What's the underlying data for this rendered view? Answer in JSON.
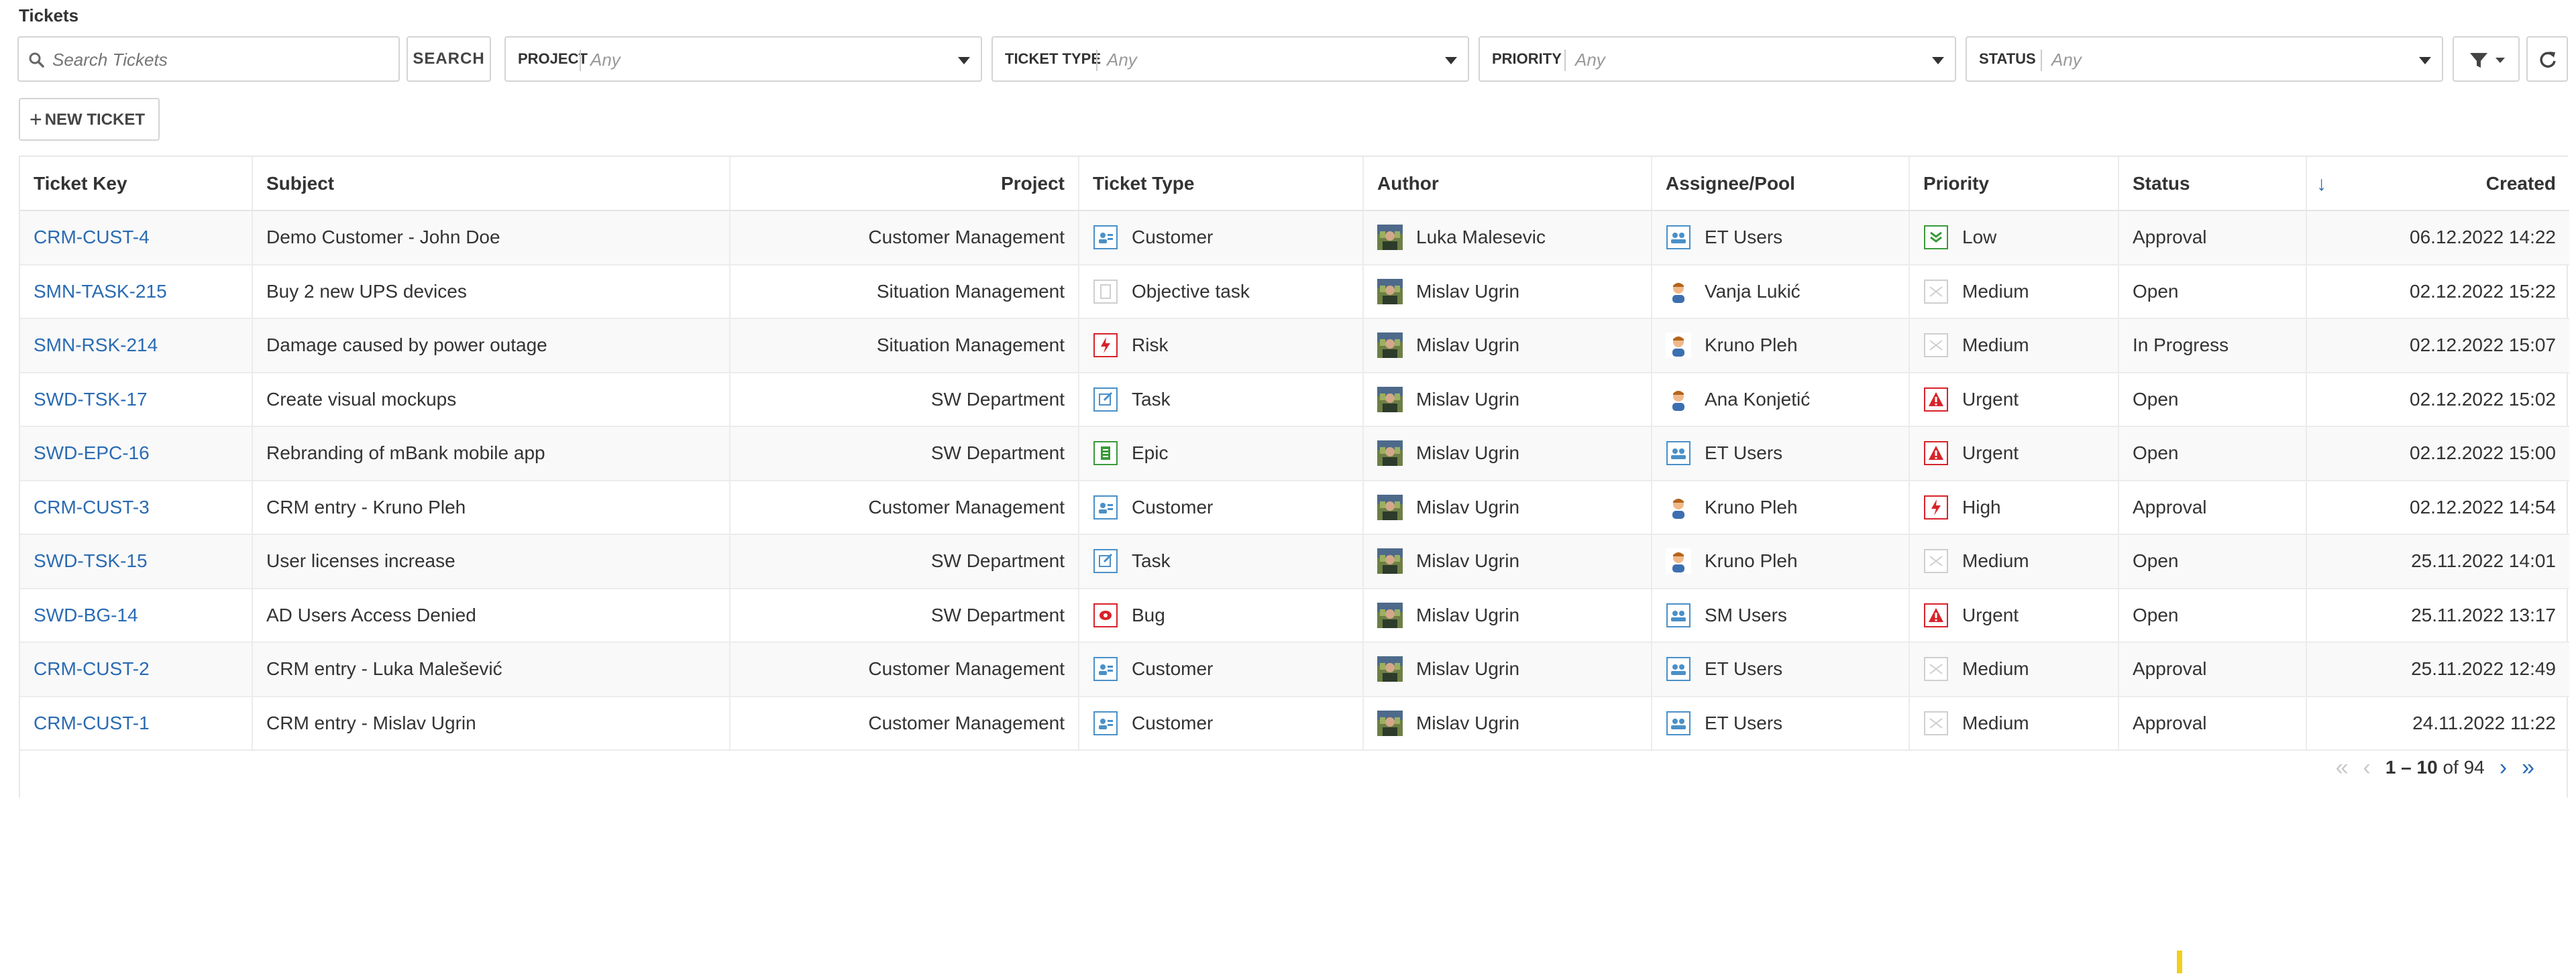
{
  "page": {
    "title": "Tickets"
  },
  "filters": {
    "search_placeholder": "Search Tickets",
    "search_button": "SEARCH",
    "project": {
      "label": "PROJECT",
      "value": "Any"
    },
    "ticket_type": {
      "label": "TICKET TYPE",
      "value": "Any"
    },
    "priority": {
      "label": "PRIORITY",
      "value": "Any"
    },
    "status": {
      "label": "STATUS",
      "value": "Any"
    }
  },
  "actions": {
    "new_ticket": "NEW TICKET"
  },
  "table": {
    "columns": [
      "Ticket Key",
      "Subject",
      "Project",
      "Ticket Type",
      "Author",
      "Assignee/Pool",
      "Priority",
      "Status",
      "Created"
    ],
    "sort": {
      "column": "Created",
      "direction": "descending"
    },
    "rows": [
      {
        "key": "CRM-CUST-4",
        "subject": "Demo Customer - John Doe",
        "project": "Customer Management",
        "type": "Customer",
        "type_icon": "customer-type-icon",
        "author": "Luka Malesevic",
        "author_icon": "author-avatar-icon",
        "assignee": "ET Users",
        "assignee_icon": "user-pool-icon",
        "priority": "Low",
        "priority_icon": "priority-low-icon",
        "status": "Approval",
        "created": "06.12.2022 14:22"
      },
      {
        "key": "SMN-TASK-215",
        "subject": "Buy 2 new UPS devices",
        "project": "Situation Management",
        "type": "Objective task",
        "type_icon": "objective-task-type-icon",
        "author": "Mislav Ugrin",
        "author_icon": "author-avatar-icon",
        "assignee": "Vanja Lukić",
        "assignee_icon": "user-avatar-icon",
        "priority": "Medium",
        "priority_icon": "priority-medium-icon",
        "status": "Open",
        "created": "02.12.2022 15:22"
      },
      {
        "key": "SMN-RSK-214",
        "subject": "Damage caused by power outage",
        "project": "Situation Management",
        "type": "Risk",
        "type_icon": "risk-type-icon",
        "author": "Mislav Ugrin",
        "author_icon": "author-avatar-icon",
        "assignee": "Kruno Pleh",
        "assignee_icon": "user-avatar-icon",
        "priority": "Medium",
        "priority_icon": "priority-medium-icon",
        "status": "In Progress",
        "created": "02.12.2022 15:07"
      },
      {
        "key": "SWD-TSK-17",
        "subject": "Create visual mockups",
        "project": "SW Department",
        "type": "Task",
        "type_icon": "task-type-icon",
        "author": "Mislav Ugrin",
        "author_icon": "author-avatar-icon",
        "assignee": "Ana Konjetić",
        "assignee_icon": "user-avatar-icon",
        "priority": "Urgent",
        "priority_icon": "priority-urgent-icon",
        "status": "Open",
        "created": "02.12.2022 15:02"
      },
      {
        "key": "SWD-EPC-16",
        "subject": "Rebranding of mBank mobile app",
        "project": "SW Department",
        "type": "Epic",
        "type_icon": "epic-type-icon",
        "author": "Mislav Ugrin",
        "author_icon": "author-avatar-icon",
        "assignee": "ET Users",
        "assignee_icon": "user-pool-icon",
        "priority": "Urgent",
        "priority_icon": "priority-urgent-icon",
        "status": "Open",
        "created": "02.12.2022 15:00"
      },
      {
        "key": "CRM-CUST-3",
        "subject": "CRM entry - Kruno Pleh",
        "project": "Customer Management",
        "type": "Customer",
        "type_icon": "customer-type-icon",
        "author": "Mislav Ugrin",
        "author_icon": "author-avatar-icon",
        "assignee": "Kruno Pleh",
        "assignee_icon": "user-avatar-icon",
        "priority": "High",
        "priority_icon": "priority-high-icon",
        "status": "Approval",
        "created": "02.12.2022 14:54"
      },
      {
        "key": "SWD-TSK-15",
        "subject": "User licenses increase",
        "project": "SW Department",
        "type": "Task",
        "type_icon": "task-type-icon",
        "author": "Mislav Ugrin",
        "author_icon": "author-avatar-icon",
        "assignee": "Kruno Pleh",
        "assignee_icon": "user-avatar-icon",
        "priority": "Medium",
        "priority_icon": "priority-medium-icon",
        "status": "Open",
        "created": "25.11.2022 14:01"
      },
      {
        "key": "SWD-BG-14",
        "subject": "AD Users Access Denied",
        "project": "SW Department",
        "type": "Bug",
        "type_icon": "bug-type-icon",
        "author": "Mislav Ugrin",
        "author_icon": "author-avatar-icon",
        "assignee": "SM Users",
        "assignee_icon": "user-pool-icon",
        "priority": "Urgent",
        "priority_icon": "priority-urgent-icon",
        "status": "Open",
        "created": "25.11.2022 13:17"
      },
      {
        "key": "CRM-CUST-2",
        "subject": "CRM entry - Luka Malešević",
        "project": "Customer Management",
        "type": "Customer",
        "type_icon": "customer-type-icon",
        "author": "Mislav Ugrin",
        "author_icon": "author-avatar-icon",
        "assignee": "ET Users",
        "assignee_icon": "user-pool-icon",
        "priority": "Medium",
        "priority_icon": "priority-medium-icon",
        "status": "Approval",
        "created": "25.11.2022 12:49"
      },
      {
        "key": "CRM-CUST-1",
        "subject": "CRM entry - Mislav Ugrin",
        "project": "Customer Management",
        "type": "Customer",
        "type_icon": "customer-type-icon",
        "author": "Mislav Ugrin",
        "author_icon": "author-avatar-icon",
        "assignee": "ET Users",
        "assignee_icon": "user-pool-icon",
        "priority": "Medium",
        "priority_icon": "priority-medium-icon",
        "status": "Approval",
        "created": "24.11.2022 11:22"
      }
    ]
  },
  "pagination": {
    "range": "1 – 10",
    "of_label": "of",
    "total": "94"
  },
  "colors": {
    "link": "#2a6bb3",
    "urgent": "#d8232a",
    "low": "#3a9a3a",
    "accent_yellow": "#f2cf1d"
  }
}
